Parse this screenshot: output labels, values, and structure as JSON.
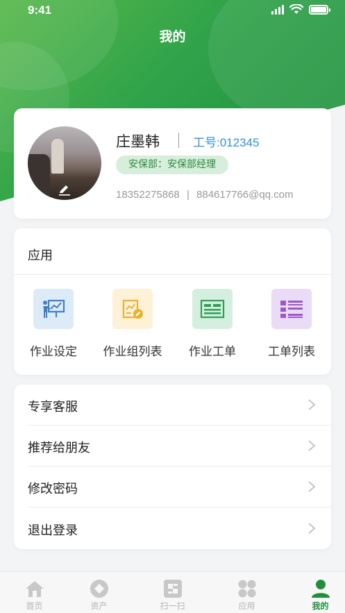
{
  "status_bar": {
    "time": "9:41"
  },
  "header": {
    "title": "我的"
  },
  "profile": {
    "name": "庄墨韩",
    "employee_no": "工号:012345",
    "department": "安保部：安保部经理",
    "phone": "18352275868",
    "separator": "|",
    "email": "884617766@qq.com"
  },
  "apps": {
    "title": "应用",
    "items": [
      {
        "label": "作业设定",
        "icon": "presentation-board-icon",
        "bg": "#ddeaf8",
        "color": "#3f7fc6"
      },
      {
        "label": "作业组列表",
        "icon": "chart-edit-icon",
        "bg": "#fdf1d8",
        "color": "#e9b22b"
      },
      {
        "label": "作业工单",
        "icon": "form-sheet-icon",
        "bg": "#d4efdf",
        "color": "#2f9e56"
      },
      {
        "label": "工单列表",
        "icon": "list-icon",
        "bg": "#eadcf6",
        "color": "#9b59c9"
      }
    ]
  },
  "menu": [
    {
      "label": "专享客服"
    },
    {
      "label": "推荐给朋友"
    },
    {
      "label": "修改密码"
    },
    {
      "label": "退出登录"
    }
  ],
  "tabbar": {
    "items": [
      {
        "label": "首页",
        "icon": "home-icon"
      },
      {
        "label": "资产",
        "icon": "asset-icon"
      },
      {
        "label": "扫一扫",
        "icon": "scan-icon"
      },
      {
        "label": "应用",
        "icon": "apps-grid-icon"
      },
      {
        "label": "我的",
        "icon": "user-icon",
        "active": true
      }
    ]
  },
  "colors": {
    "brand_green": "#2fa24a",
    "link_blue": "#2f8fe0",
    "active_tab": "#1f8f3c"
  }
}
